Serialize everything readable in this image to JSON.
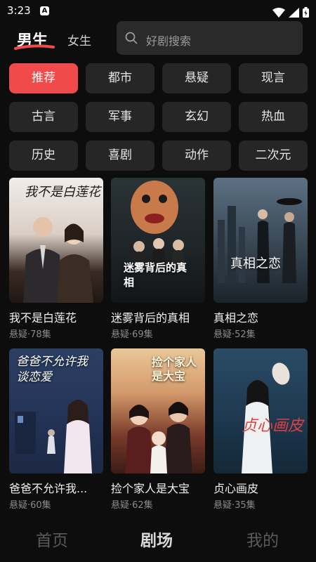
{
  "status_bar": {
    "time": "3:23",
    "notification_glyph": "A"
  },
  "header": {
    "tab_male": "男生",
    "tab_female": "女生",
    "search_placeholder": "好剧搜索",
    "accent_color": "#f04a4a"
  },
  "categories": [
    "推荐",
    "都市",
    "悬疑",
    "现言",
    "古言",
    "军事",
    "玄幻",
    "热血",
    "历史",
    "喜剧",
    "动作",
    "二次元"
  ],
  "active_category": "推荐",
  "dramas": [
    {
      "title": "我不是白莲花",
      "meta": "悬疑·78集",
      "poster_text": "我不是白莲花"
    },
    {
      "title": "迷雾背后的真相",
      "meta": "悬疑·69集",
      "poster_text": "迷雾背后的真相"
    },
    {
      "title": "真相之恋",
      "meta": "悬疑·52集",
      "poster_text": "真相之恋"
    },
    {
      "title": "爸爸不允许我...",
      "meta": "悬疑·60集",
      "poster_text": "爸爸不允许我谈恋爱"
    },
    {
      "title": "捡个家人是大宝",
      "meta": "悬疑·62集",
      "poster_text": "捡个家人是大宝"
    },
    {
      "title": "贞心画皮",
      "meta": "悬疑·35集",
      "poster_text": "贞心画皮"
    }
  ],
  "bottom_nav": {
    "home": "首页",
    "theater": "剧场",
    "mine": "我的"
  }
}
